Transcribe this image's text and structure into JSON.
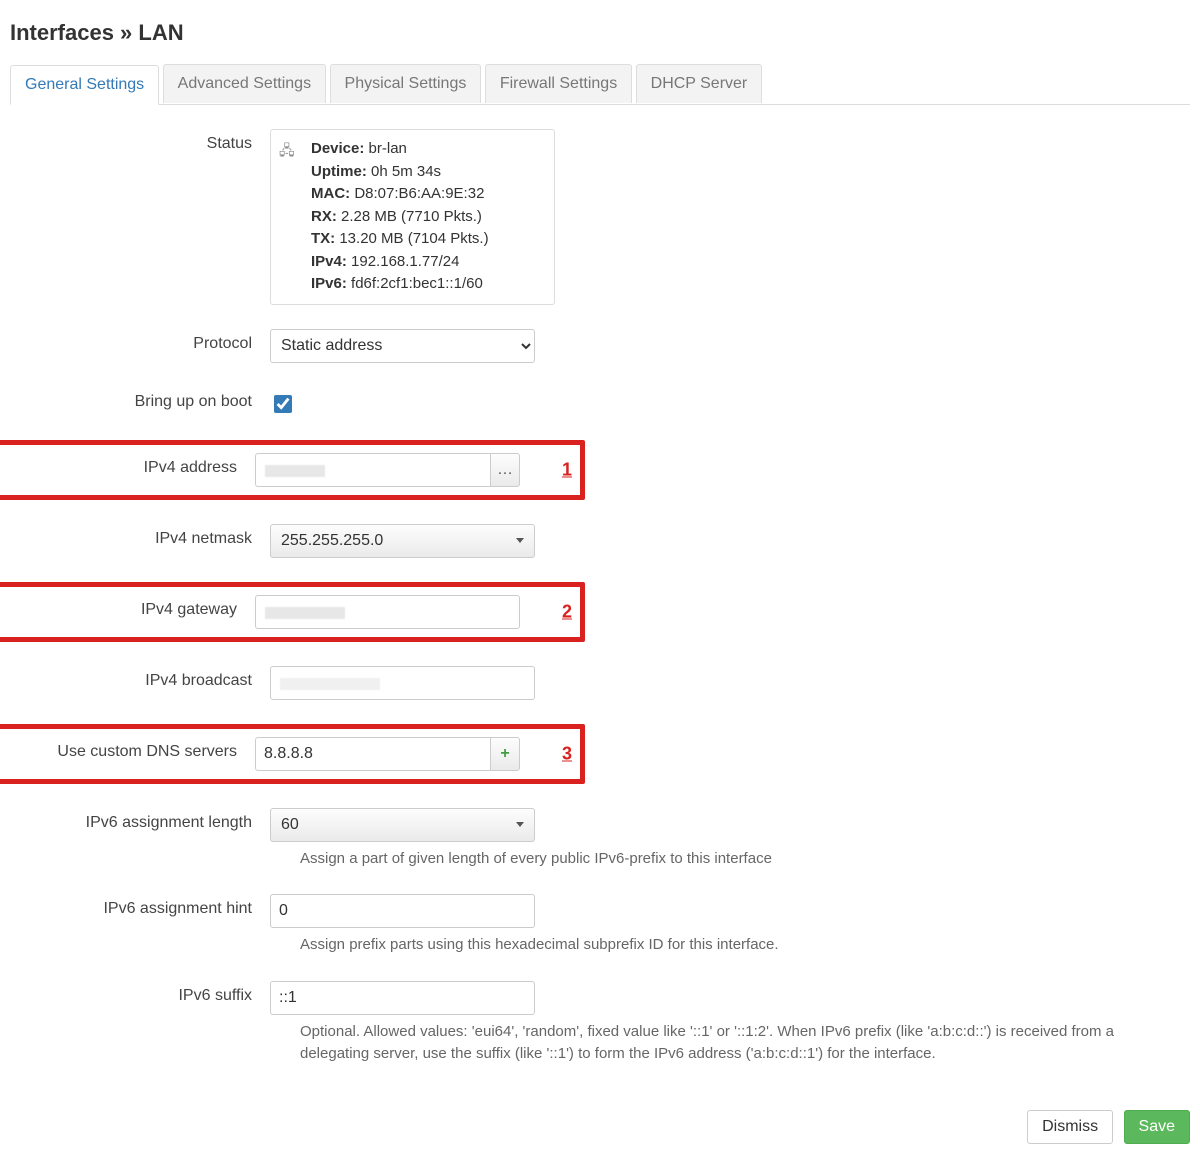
{
  "page": {
    "title": "Interfaces » LAN"
  },
  "tabs": [
    {
      "label": "General Settings",
      "active": true
    },
    {
      "label": "Advanced Settings",
      "active": false
    },
    {
      "label": "Physical Settings",
      "active": false
    },
    {
      "label": "Firewall Settings",
      "active": false
    },
    {
      "label": "DHCP Server",
      "active": false
    }
  ],
  "labels": {
    "status": "Status",
    "protocol": "Protocol",
    "bring_up": "Bring up on boot",
    "ipv4_address": "IPv4 address",
    "ipv4_netmask": "IPv4 netmask",
    "ipv4_gateway": "IPv4 gateway",
    "ipv4_broadcast": "IPv4 broadcast",
    "dns": "Use custom DNS servers",
    "ipv6_len": "IPv6 assignment length",
    "ipv6_hint": "IPv6 assignment hint",
    "ipv6_suffix": "IPv6 suffix"
  },
  "status": {
    "device_label": "Device:",
    "device": "br-lan",
    "uptime_label": "Uptime:",
    "uptime": "0h 5m 34s",
    "mac_label": "MAC:",
    "mac": "D8:07:B6:AA:9E:32",
    "rx_label": "RX:",
    "rx": "2.28 MB (7710 Pkts.)",
    "tx_label": "TX:",
    "tx": "13.20 MB (7104 Pkts.)",
    "ipv4_label": "IPv4:",
    "ipv4": "192.168.1.77/24",
    "ipv6_label": "IPv6:",
    "ipv6": "fd6f:2cf1:bec1::1/60"
  },
  "fields": {
    "protocol": "Static address",
    "bring_up_on_boot": true,
    "ipv4_address": "",
    "ipv4_netmask": "255.255.255.0",
    "ipv4_gateway": "",
    "ipv4_broadcast": "",
    "dns_server": "8.8.8.8",
    "ipv6_assignment_length": "60",
    "ipv6_assignment_hint": "0",
    "ipv6_suffix": "::1"
  },
  "help": {
    "ipv6_len": "Assign a part of given length of every public IPv6-prefix to this interface",
    "ipv6_hint": "Assign prefix parts using this hexadecimal subprefix ID for this interface.",
    "ipv6_suffix": "Optional. Allowed values: 'eui64', 'random', fixed value like '::1' or '::1:2'. When IPv6 prefix (like 'a:b:c:d::') is received from a delegating server, use the suffix (like '::1') to form the IPv6 address ('a:b:c:d::1') for the interface."
  },
  "annotations": {
    "n1": "1",
    "n2": "2",
    "n3": "3"
  },
  "buttons": {
    "dismiss": "Dismiss",
    "save": "Save",
    "more": "…",
    "add": "+"
  }
}
